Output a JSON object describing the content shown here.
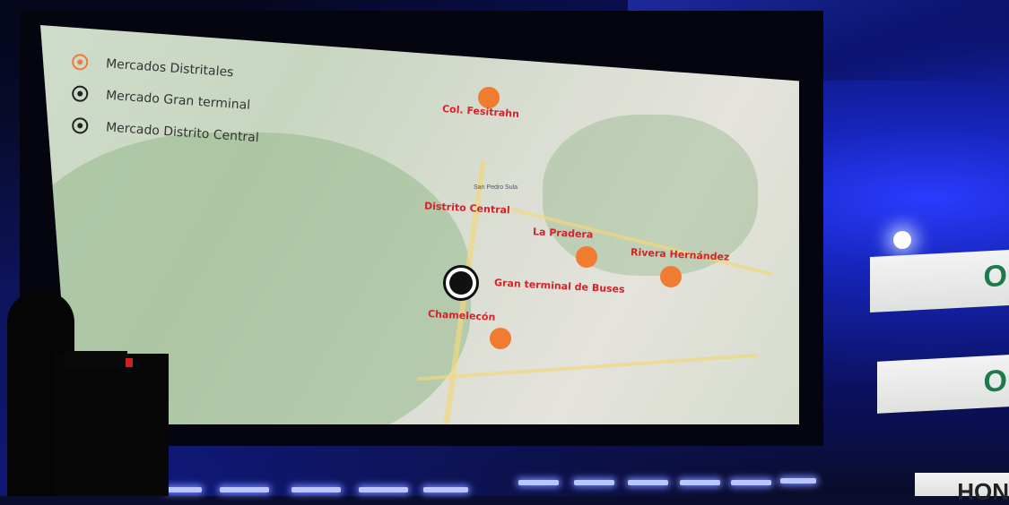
{
  "legend": [
    {
      "label": "Mercados Distritales",
      "icon": "orange-ring-icon"
    },
    {
      "label": "Mercado Gran terminal",
      "icon": "dark-ring-icon"
    },
    {
      "label": "Mercado Distrito Central",
      "icon": "dark-ring-icon"
    }
  ],
  "markets": {
    "fesitrahn": "Col. Fesitrahn",
    "distrito_central": "Distrito Central",
    "la_pradera": "La Pradera",
    "rivera_hernandez": "Rivera Hernández",
    "gran_terminal": "Gran terminal de Buses",
    "chamelecon": "Chamelecón"
  },
  "map_labels": {
    "san_pedro_sula": "San Pedro Sula"
  },
  "side_panels": {
    "top": "O",
    "middle": "O",
    "bottom": "HON"
  },
  "colors": {
    "market_orange": "#f07c32",
    "label_red": "#d6222a",
    "panel_green": "#1e7a4a"
  }
}
